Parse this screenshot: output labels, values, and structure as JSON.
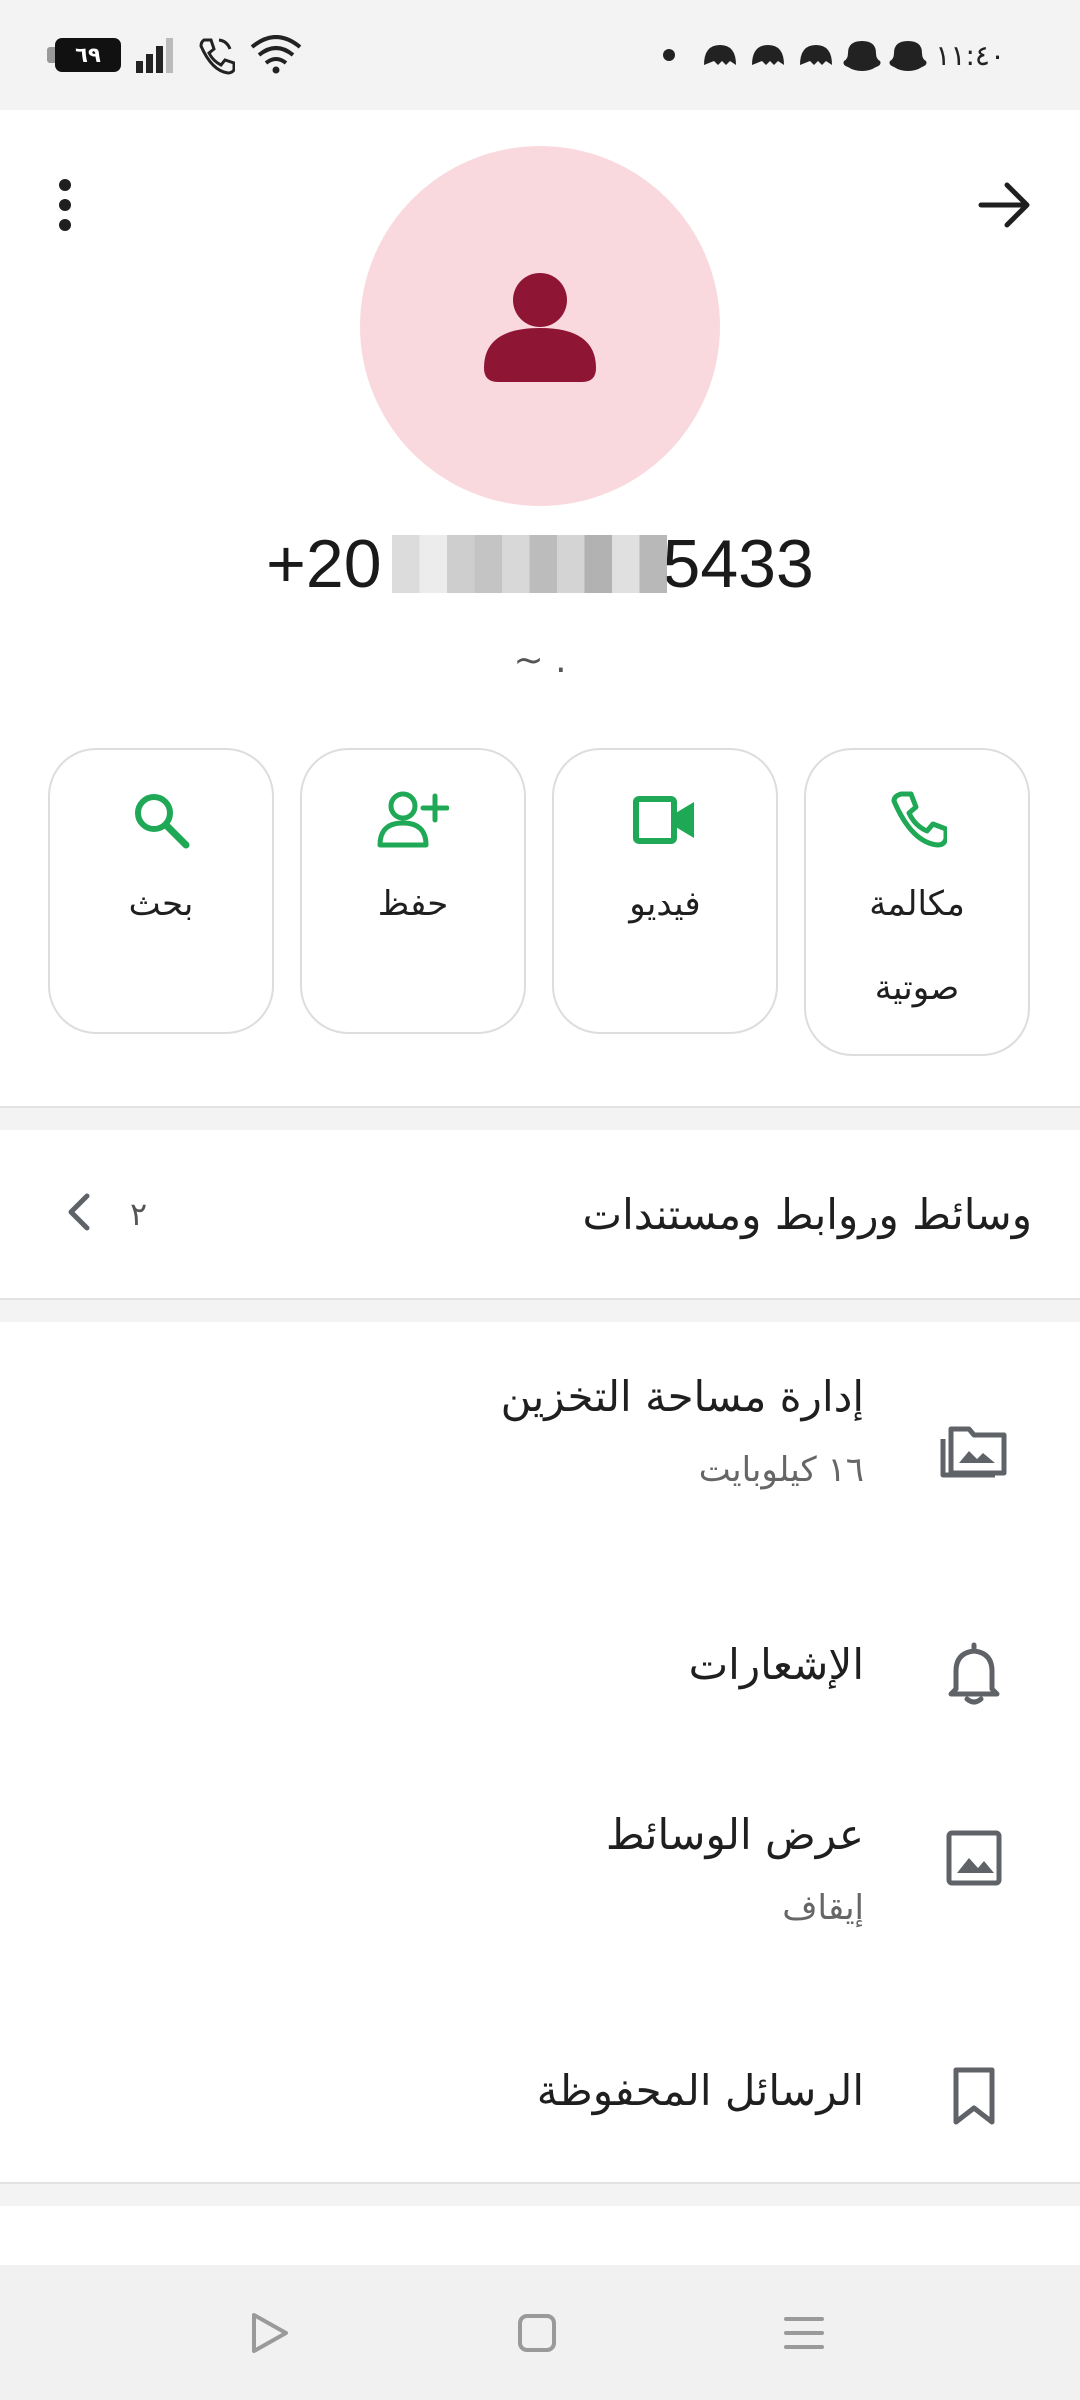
{
  "status_bar": {
    "battery": "٦٩",
    "time": "١١:٤٠"
  },
  "contact": {
    "phone_prefix": "+20",
    "phone_suffix": "5433",
    "name_hint": "~ ."
  },
  "actions": [
    {
      "label": "بحث",
      "icon": "search-icon"
    },
    {
      "label": "حفظ",
      "icon": "add-person-icon"
    },
    {
      "label": "فيديو",
      "icon": "video-icon"
    },
    {
      "label": "مكالمة صوتية",
      "label_line1": "مكالمة",
      "label_line2": "صوتية",
      "icon": "phone-icon"
    }
  ],
  "media_section": {
    "title": "وسائط وروابط ومستندات",
    "count": "٢"
  },
  "settings": {
    "storage": {
      "title": "إدارة مساحة التخزين",
      "subtitle": "١٦ كيلوبايت"
    },
    "notifications": {
      "title": "الإشعارات"
    },
    "media_visibility": {
      "title": "عرض الوسائط",
      "subtitle": "إيقاف"
    },
    "saved_messages": {
      "title": "الرسائل المحفوظة"
    }
  },
  "colors": {
    "accent": "#1fa855",
    "avatar_bg": "#fad9de",
    "avatar_fg": "#8f1535",
    "icon_gray": "#5f6368"
  }
}
